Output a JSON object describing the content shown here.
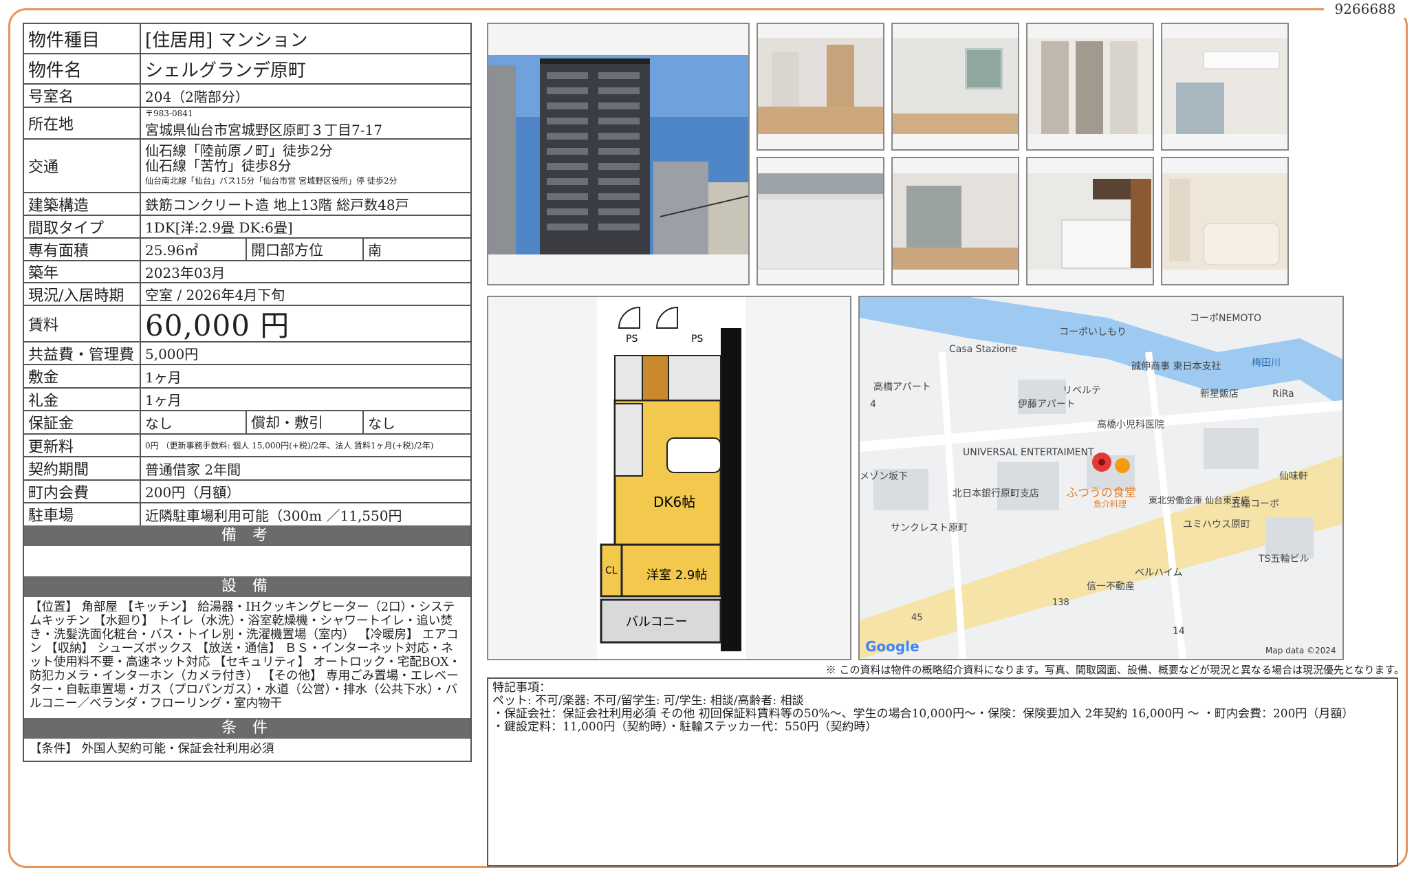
{
  "doc_id": "9266688",
  "rows": {
    "type": {
      "label": "物件種目",
      "value": "[住居用]  マンション"
    },
    "name": {
      "label": "物件名",
      "value": "シェルグランデ原町"
    },
    "room": {
      "label": "号室名",
      "value": "204（2階部分）"
    },
    "address": {
      "label": "所在地",
      "postal": "〒983-0841",
      "value": "宮城県仙台市宮城野区原町３丁目7-17"
    },
    "transport": {
      "label": "交通",
      "line1": "仙石線「陸前原ノ町」徒歩2分",
      "line2": "仙石線「苦竹」徒歩8分",
      "line3": "仙台南北線「仙台」バス15分「仙台市営  宮城野区役所」停  徒歩2分"
    },
    "structure": {
      "label": "建築構造",
      "value": "鉄筋コンクリート造  地上13階  総戸数48戸"
    },
    "layout": {
      "label": "間取タイプ",
      "value": "1DK[洋:2.9畳  DK:6畳]"
    },
    "area": {
      "label": "専有面積",
      "value": "25.96㎡",
      "label2": "開口部方位",
      "value2": "南"
    },
    "built": {
      "label": "築年",
      "value": "2023年03月"
    },
    "status": {
      "label": "現況/入居時期",
      "value": "空室  /  2026年4月下旬"
    },
    "rent": {
      "label": "賃料",
      "value": "60,000 円"
    },
    "common": {
      "label": "共益費・管理費",
      "value": "5,000円"
    },
    "deposit": {
      "label": "敷金",
      "value": "1ヶ月"
    },
    "key_money": {
      "label": "礼金",
      "value": "1ヶ月"
    },
    "guarantee": {
      "label": "保証金",
      "value": "なし",
      "label2": "償却・敷引",
      "value2": "なし"
    },
    "renewal": {
      "label": "更新料",
      "value": "0円  （更新事務手数料: 個人 15,000円(+税)/2年、法人  賃料1ヶ月(+税)/2年)"
    },
    "contract": {
      "label": "契約期間",
      "value": "普通借家  2年間"
    },
    "town_fee": {
      "label": "町内会費",
      "value": "200円（月額）"
    },
    "parking": {
      "label": "駐車場",
      "value": "近隣駐車場利用可能（300m  ／11,550円"
    }
  },
  "sections": {
    "remarks_title": "備  考",
    "equipment_title": "設  備",
    "conditions_title": "条  件"
  },
  "equipment_text": "【位置】 角部屋 【キッチン】 給湯器・IHクッキングヒーター（2口）・システムキッチン 【水廻り】 トイレ（水洗）・浴室乾燥機・シャワートイレ・追い焚き・洗髪洗面化粧台・バス・トイレ別・洗濯機置場（室内） 【冷暖房】 エアコン 【収納】 シューズボックス 【放送・通信】 ＢＳ・インターネット対応・ネット使用料不要・高速ネット対応 【セキュリティ】 オートロック・宅配BOX・防犯カメラ・インターホン（カメラ付き） 【その他】 専用ごみ置場・エレベーター・自転車置場・ガス（プロパンガス）・水道（公営）・排水（公共下水）・バルコニー／ベランダ・フローリング・室内物干",
  "conditions_text": "【条件】 外国人契約可能・保証会社利用必須",
  "floorplan": {
    "dk_label": "DK6帖",
    "room_label": "洋室 2.9帖",
    "balcony_label": "バルコニー",
    "ps_label": "PS",
    "cl_label": "CL"
  },
  "map": {
    "labels": [
      "コーポNEMOTO",
      "コーポいしもり",
      "Casa Stazione",
      "梅田川",
      "誠伸商事 東日本支社",
      "高橋アパート",
      "リベルテ",
      "新星飯店",
      "RiRa",
      "伊藤アパート",
      "高橋小児科医院",
      "UNIVERSAL ENTERTAIMENT",
      "メゾン坂下",
      "北日本銀行原町支店",
      "ふつうの食堂",
      "魚介料理",
      "東北労働金庫 仙台東支店",
      "五輪コーポ",
      "仙味軒",
      "サンクレスト原町",
      "ユミハウス原町",
      "TS五輪ビル",
      "ベルハイム",
      "信一不動産",
      "138",
      "45",
      "14",
      "4"
    ],
    "logo": "Google",
    "credit": "Map data ©2024"
  },
  "disclaimer": "※ この資料は物件の概略紹介資料になります。写真、間取図面、設備、概要などが現況と異なる場合は現況優先となります。",
  "special_notes": {
    "title": "特記事項：",
    "line1": "ペット: 不可/楽器: 不可/留学生: 可/学生: 相談/高齢者: 相談",
    "line2": "・保証会社：保証会社利用必須  その他  初回保証料賃料等の50%～、学生の場合10,000円～・保険：保険要加入  2年契約  16,000円  ～  ・町内会費：200円（月額）",
    "line3": "・鍵設定料：11,000円（契約時）・駐輪ステッカー代：550円（契約時）"
  }
}
